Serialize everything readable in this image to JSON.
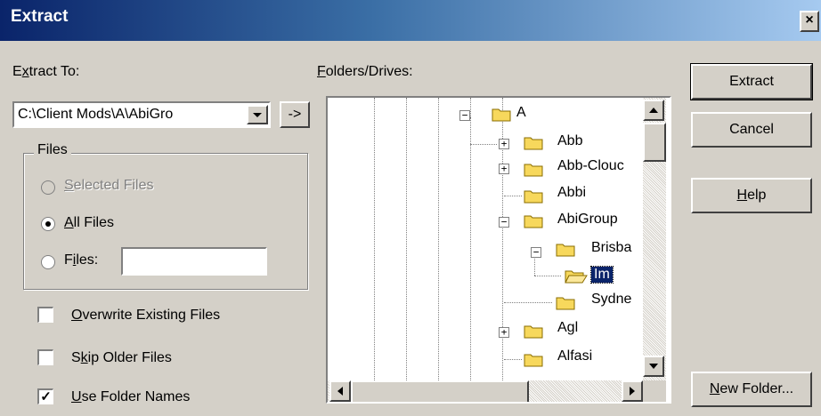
{
  "window": {
    "title": "Extract",
    "close_label": "×"
  },
  "extract_to": {
    "label_prefix": "E",
    "label_underline": "x",
    "label_rest": "tract To:",
    "path_value": "C:\\Client Mods\\A\\AbiGro",
    "browse_label": "->"
  },
  "files_group": {
    "title": "Files",
    "selected_files": {
      "underline": "S",
      "rest": "elected Files"
    },
    "all_files": {
      "underline": "A",
      "rest": "ll Files"
    },
    "files": {
      "prefix": "F",
      "underline": "i",
      "rest": "les:",
      "value": ""
    }
  },
  "options": {
    "overwrite": {
      "underline": "O",
      "rest": "verwrite Existing Files",
      "checked": false
    },
    "skip_older": {
      "prefix": "S",
      "underline": "k",
      "rest": "ip Older Files",
      "checked": false
    },
    "use_folder_names": {
      "underline": "U",
      "rest": "se Folder Names",
      "checked": true
    }
  },
  "folders": {
    "label_underline": "F",
    "label_rest": "olders/Drives:",
    "items": [
      {
        "label": "A",
        "expander": "−"
      },
      {
        "label": "Abb",
        "expander": "+"
      },
      {
        "label": "Abb-Clouc",
        "expander": "+"
      },
      {
        "label": "Abbi",
        "expander": ""
      },
      {
        "label": "AbiGroup",
        "expander": "−"
      },
      {
        "label": "Brisba",
        "expander": "−"
      },
      {
        "label": "Im",
        "expander": ""
      },
      {
        "label": "Sydne",
        "expander": ""
      },
      {
        "label": "Agl",
        "expander": "+"
      },
      {
        "label": "Alfasi",
        "expander": ""
      }
    ]
  },
  "buttons": {
    "extract": "Extract",
    "cancel": "Cancel",
    "help_underline": "H",
    "help_rest": "elp",
    "newfolder_underline": "N",
    "newfolder_rest": "ew Folder..."
  },
  "colors": {
    "title_start": "#0a246a",
    "title_end": "#a6caf0",
    "face": "#d4d0c8",
    "selection": "#0a246a",
    "folder": "#f7d85c"
  }
}
